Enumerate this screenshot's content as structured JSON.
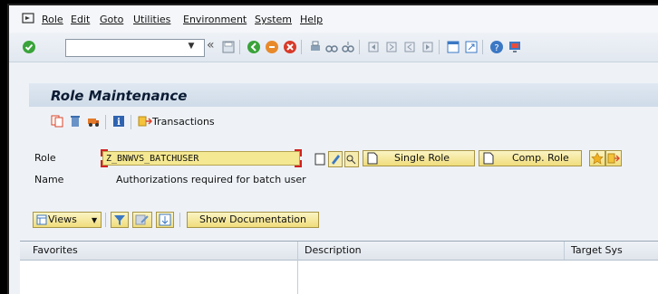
{
  "menu": {
    "items": [
      "Role",
      "Edit",
      "Goto",
      "Utilities",
      "Environment",
      "System",
      "Help"
    ]
  },
  "toolbar": {
    "command_field_value": "",
    "back_symbol": "«"
  },
  "title": "Role Maintenance",
  "app_toolbar": {
    "transactions_label": "Transactions"
  },
  "form": {
    "role_label": "Role",
    "role_value": "Z_BNWVS_BATCHUSER",
    "name_label": "Name",
    "name_value": "Authorizations required for batch user",
    "single_role_button": "Single Role",
    "comp_role_button": "Comp. Role"
  },
  "list_toolbar": {
    "views_button": "Views",
    "show_documentation_button": "Show Documentation"
  },
  "table": {
    "columns": [
      "Favorites",
      "Description",
      "Target Sys"
    ]
  },
  "colors": {
    "title_text": "#0b1b33",
    "required_field_bg": "#f5e892",
    "button_yellow": "#f0dd7c",
    "frame_bg": "#eef2f7"
  },
  "icons": [
    "menu-icon",
    "check-icon",
    "dropdown-icon",
    "save-icon",
    "back-icon",
    "exit-icon",
    "cancel-icon",
    "print-icon",
    "find-icon",
    "find-next-icon",
    "first-page-icon",
    "prev-page-icon",
    "next-page-icon",
    "last-page-icon",
    "new-session-icon",
    "shortcut-icon",
    "help-icon",
    "customize-icon",
    "copy-icon",
    "delete-icon",
    "transport-icon",
    "info-icon",
    "transactions-icon",
    "display-icon",
    "edit-pencil-icon",
    "where-used-icon",
    "page-icon",
    "favorites-icon",
    "other-object-icon",
    "filter-icon",
    "edit-list-icon",
    "sort-icon"
  ]
}
